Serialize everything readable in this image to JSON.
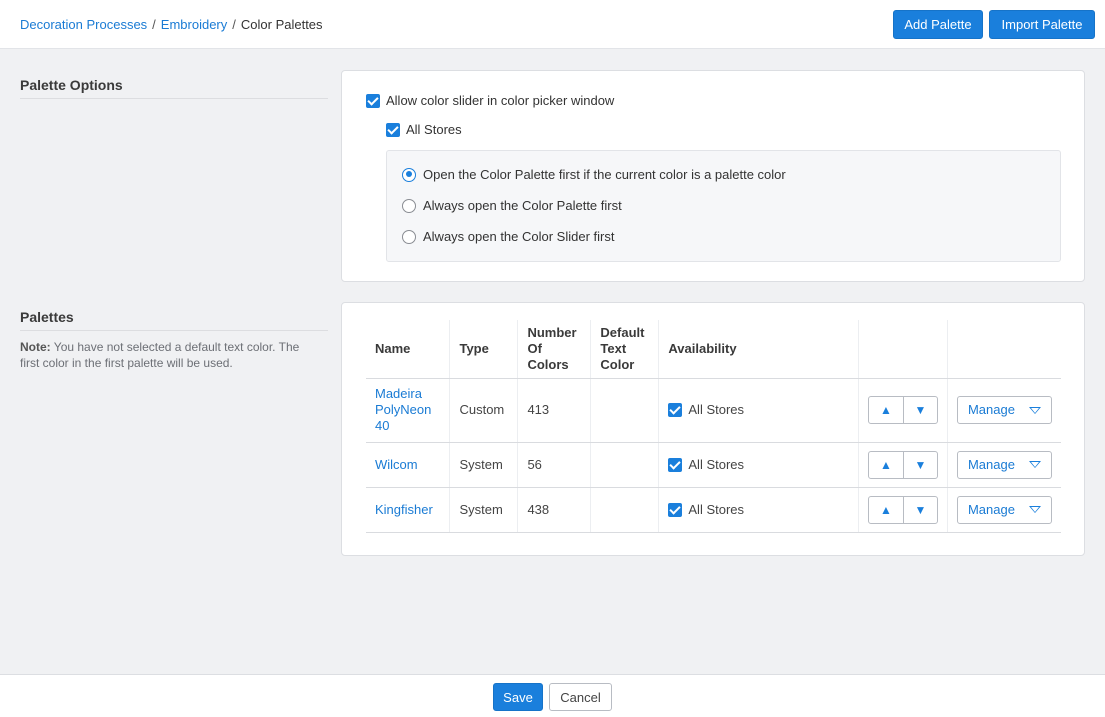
{
  "breadcrumb": {
    "items": [
      "Decoration Processes",
      "Embroidery"
    ],
    "current": "Color Palettes",
    "separator": "/"
  },
  "header": {
    "add_palette": "Add Palette",
    "import_palette": "Import Palette"
  },
  "palette_options": {
    "title": "Palette Options",
    "allow_slider_label": "Allow color slider in color picker window",
    "allow_slider_checked": true,
    "all_stores_label": "All Stores",
    "all_stores_checked": true,
    "radio_options": [
      {
        "label": "Open the Color Palette first if the current color is a palette color",
        "selected": true
      },
      {
        "label": "Always open the Color Palette first",
        "selected": false
      },
      {
        "label": "Always open the Color Slider first",
        "selected": false
      }
    ]
  },
  "palettes": {
    "title": "Palettes",
    "note_label": "Note:",
    "note_text": " You have not selected a default text color. The first color in the first palette will be used.",
    "columns": [
      "Name",
      "Type",
      "Number Of Colors",
      "Default Text Color",
      "Availability"
    ],
    "rows": [
      {
        "name": "Madeira PolyNeon 40",
        "type": "Custom",
        "count": "413",
        "default_text_color": "",
        "availability": "All Stores"
      },
      {
        "name": "Wilcom",
        "type": "System",
        "count": "56",
        "default_text_color": "",
        "availability": "All Stores"
      },
      {
        "name": "Kingfisher",
        "type": "System",
        "count": "438",
        "default_text_color": "",
        "availability": "All Stores"
      }
    ],
    "manage_label": "Manage",
    "up_icon": "▲",
    "down_icon": "▼"
  },
  "footer": {
    "save": "Save",
    "cancel": "Cancel"
  },
  "colors": {
    "accent": "#1a7fdc",
    "link": "#1a7bd4",
    "background": "#f0f1f3"
  }
}
